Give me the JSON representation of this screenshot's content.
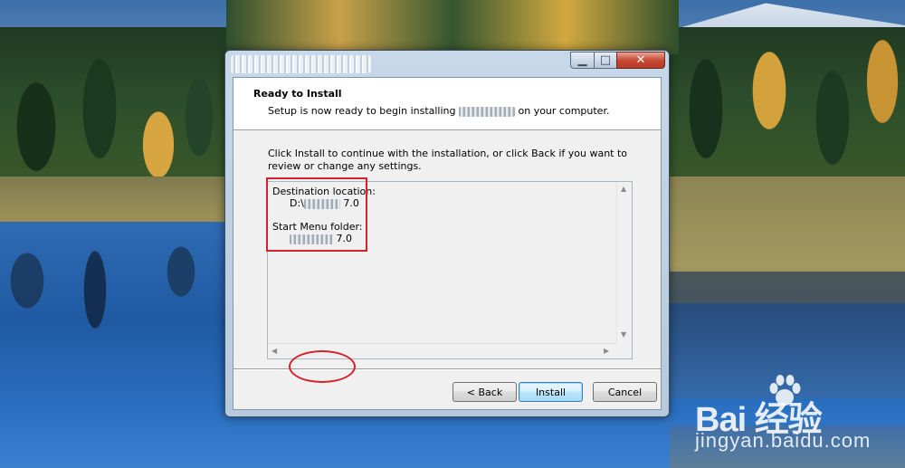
{
  "window": {
    "header_title": "Ready to Install",
    "header_subtitle_start": "Setup is now ready to begin installing ",
    "header_subtitle_end": " on your computer."
  },
  "intro": {
    "text": "Click Install to continue with the installation, or click Back if you want to review or change any settings."
  },
  "memo": {
    "dest_label": "Destination location:",
    "dest_prefix": "D:\\",
    "dest_suffix": " 7.0",
    "start_label": "Start Menu folder:",
    "start_suffix": " 7.0"
  },
  "buttons": {
    "back": "< Back",
    "install": "Install",
    "cancel": "Cancel"
  },
  "titlebar_controls": {
    "min_glyph": "▁",
    "max_glyph": "□",
    "close_glyph": "✕"
  },
  "watermark": {
    "brand": "Bai  经验",
    "url": "jingyan.baidu.com"
  },
  "colors": {
    "annotation_red": "#d8202a"
  }
}
